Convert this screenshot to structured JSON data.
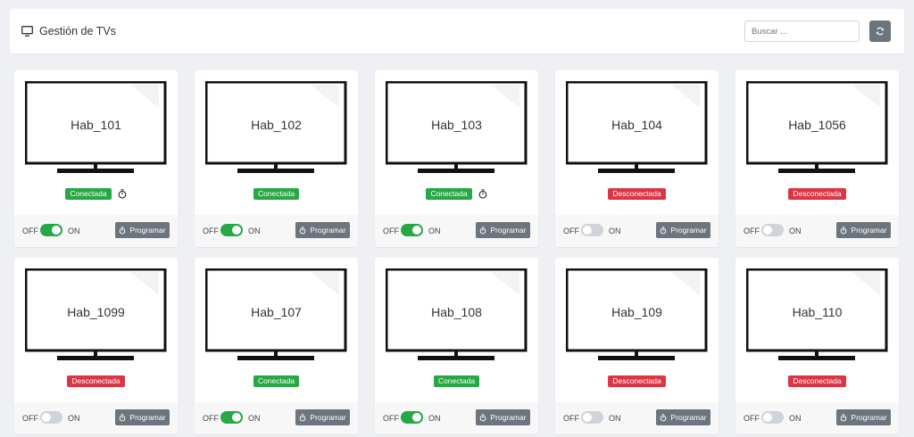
{
  "header": {
    "title": "Gestión de TVs",
    "icon": "monitor-icon"
  },
  "search": {
    "placeholder": "Buscar ..."
  },
  "refresh": {
    "icon": "sync-icon"
  },
  "labels": {
    "off": "OFF",
    "on": "ON",
    "program": "Programar"
  },
  "colors": {
    "connected": "#28a745",
    "disconnected": "#dc3545",
    "button": "#6c757d",
    "toggle_on": "#28a745",
    "toggle_off": "#ced4da"
  },
  "tvs": [
    {
      "name": "Hab_101",
      "status": "Conectada",
      "connected": true,
      "power_on": true,
      "timer": true
    },
    {
      "name": "Hab_102",
      "status": "Conectada",
      "connected": true,
      "power_on": true,
      "timer": false
    },
    {
      "name": "Hab_103",
      "status": "Conectada",
      "connected": true,
      "power_on": true,
      "timer": true
    },
    {
      "name": "Hab_104",
      "status": "Desconectada",
      "connected": false,
      "power_on": false,
      "timer": false
    },
    {
      "name": "Hab_1056",
      "status": "Desconectada",
      "connected": false,
      "power_on": false,
      "timer": false
    },
    {
      "name": "Hab_1099",
      "status": "Desconectada",
      "connected": false,
      "power_on": false,
      "timer": false
    },
    {
      "name": "Hab_107",
      "status": "Conectada",
      "connected": true,
      "power_on": true,
      "timer": false
    },
    {
      "name": "Hab_108",
      "status": "Conectada",
      "connected": true,
      "power_on": true,
      "timer": false
    },
    {
      "name": "Hab_109",
      "status": "Desconectada",
      "connected": false,
      "power_on": false,
      "timer": false
    },
    {
      "name": "Hab_110",
      "status": "Desconectada",
      "connected": false,
      "power_on": false,
      "timer": false
    }
  ]
}
